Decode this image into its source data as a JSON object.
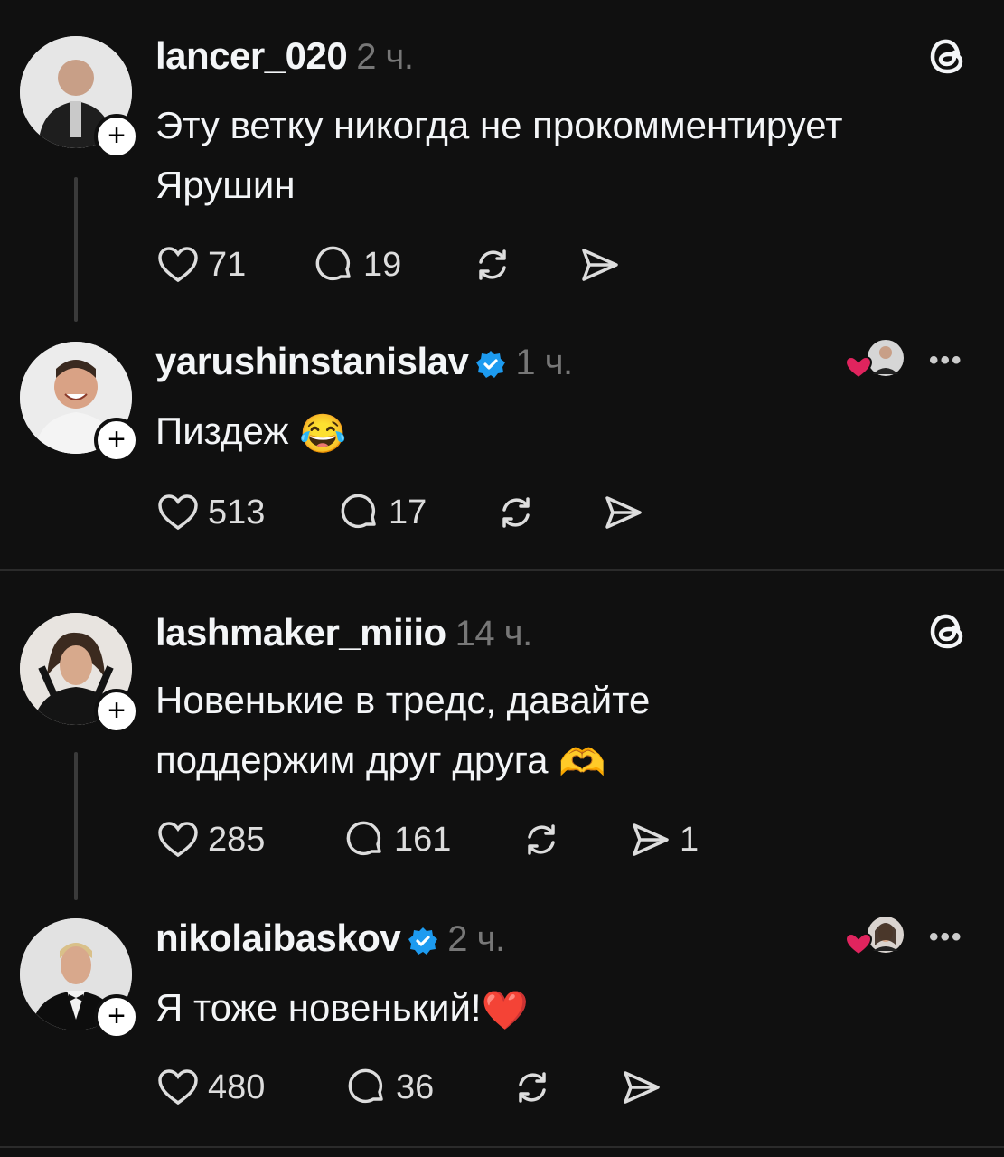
{
  "posts": [
    {
      "username": "lancer_020",
      "time": "2 ч.",
      "text": "Эту ветку никогда не прокомментирует Ярушин",
      "likes": "71",
      "replies": "19"
    },
    {
      "username": "yarushinstanislav",
      "time": "1 ч.",
      "text": "Пиздеж",
      "emoji": "😂",
      "likes": "513",
      "replies": "17"
    },
    {
      "username": "lashmaker_miiio",
      "time": "14 ч.",
      "text_line1": "Новенькие в тредс, давайте",
      "text_line2": "поддержим друг друга",
      "emoji": "🫶",
      "likes": "285",
      "replies": "161",
      "shares": "1"
    },
    {
      "username": "nikolaibaskov",
      "time": "2 ч.",
      "text": "Я тоже новенький!",
      "emoji": "❤️",
      "likes": "480",
      "replies": "36"
    }
  ],
  "follow_label": "+",
  "more_label": "•••",
  "icons": [
    "heart-icon",
    "comment-icon",
    "repost-icon",
    "share-icon",
    "threads-logo-icon",
    "verified-icon"
  ],
  "colors": {
    "background": "#101010",
    "text": "#f3f5f7",
    "muted": "#777777",
    "verified": "#1d9bf0",
    "like_red": "#e0245e"
  }
}
